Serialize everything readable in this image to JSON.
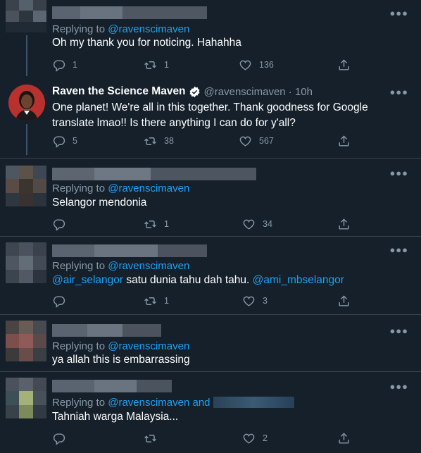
{
  "colors": {
    "background": "#15202b",
    "divider": "#38444d",
    "link": "#1da1f2",
    "muted": "#8899a6",
    "text": "#ffffff"
  },
  "icons": [
    "more-icon",
    "reply-icon",
    "retweet-icon",
    "like-icon",
    "share-icon",
    "verified-badge-icon"
  ],
  "tweets": [
    {
      "replying_label": "Replying to",
      "replying_handle": "@ravenscimaven",
      "text": "Oh my thank you for noticing. Hahahha",
      "replies": "1",
      "retweets": "1",
      "likes": "136"
    },
    {
      "name": "Raven the Science Maven",
      "handle_time": "@ravenscimaven · 10h",
      "text": "One planet! We're all in this together. Thank goodness for Google translate lmao!! Is there anything I can do for y'all?",
      "replies": "5",
      "retweets": "38",
      "likes": "567"
    },
    {
      "replying_label": "Replying to",
      "replying_handle": "@ravenscimaven",
      "text": "Selangor mendonia",
      "replies": "",
      "retweets": "1",
      "likes": "34"
    },
    {
      "replying_label": "Replying to",
      "replying_handle": "@ravenscimaven",
      "mention1": "@air_selangor",
      "text_middle": " satu dunia tahu dah tahu. ",
      "mention2": "@ami_mbselangor",
      "replies": "",
      "retweets": "1",
      "likes": "3"
    },
    {
      "replying_label": "Replying to",
      "replying_handle": "@ravenscimaven",
      "text": "ya allah this is embarrassing"
    },
    {
      "replying_label": "Replying to",
      "replying_handle": "@ravenscimaven and",
      "text": "Tahniah warga Malaysia...",
      "replies": "",
      "retweets": "",
      "likes": "2"
    }
  ]
}
